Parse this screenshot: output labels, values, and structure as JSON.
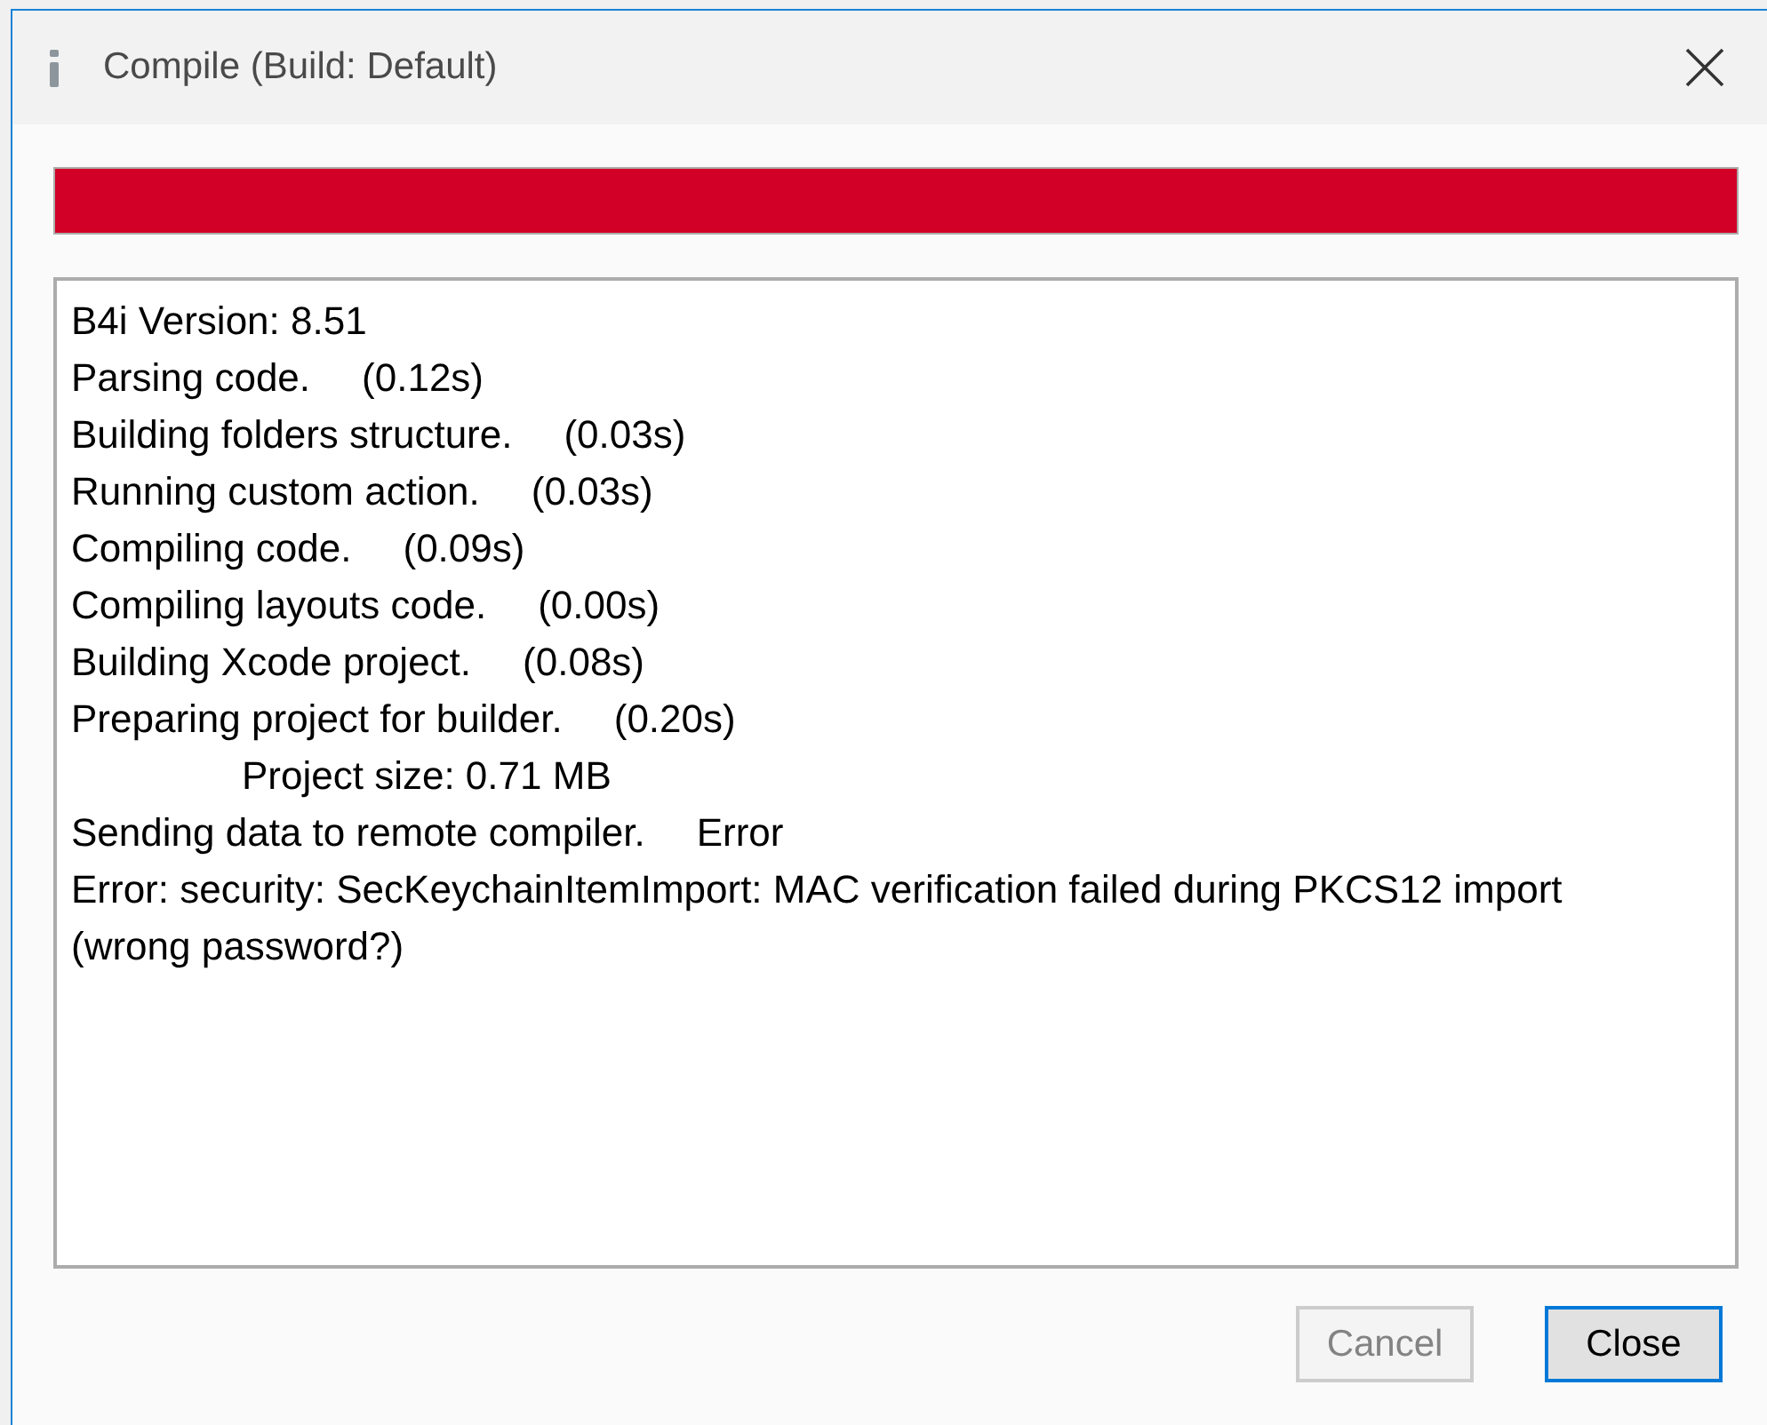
{
  "window": {
    "title": "Compile (Build: Default)"
  },
  "progress": {
    "level": 1,
    "error": true
  },
  "log": {
    "lines": [
      {
        "message": "B4i Version: 8.51",
        "indented": false
      },
      {
        "message": "Parsing code.",
        "result": "(0.12s)",
        "indented": false
      },
      {
        "message": "Building folders structure.",
        "result": "(0.03s)",
        "indented": false
      },
      {
        "message": "Running custom action.",
        "result": "(0.03s)",
        "indented": false
      },
      {
        "message": "Compiling code.",
        "result": "(0.09s)",
        "indented": false
      },
      {
        "message": "Compiling layouts code.",
        "result": "(0.00s)",
        "indented": false
      },
      {
        "message": "Building Xcode project.",
        "result": "(0.08s)",
        "indented": false
      },
      {
        "message": "Preparing project for builder.",
        "result": "(0.20s)",
        "indented": false
      },
      {
        "message": "Project size: 0.71 MB",
        "indented": true
      },
      {
        "message": "Sending data to remote compiler.",
        "result": "Error",
        "indented": false
      },
      {
        "message": "Error: security: SecKeychainItemImport: MAC verification failed during PKCS12 import (wrong password?)",
        "indented": false
      }
    ]
  },
  "buttons": [
    {
      "label": "Cancel",
      "disabled": true,
      "focused": false
    },
    {
      "label": "Close",
      "disabled": false,
      "focused": true
    }
  ]
}
